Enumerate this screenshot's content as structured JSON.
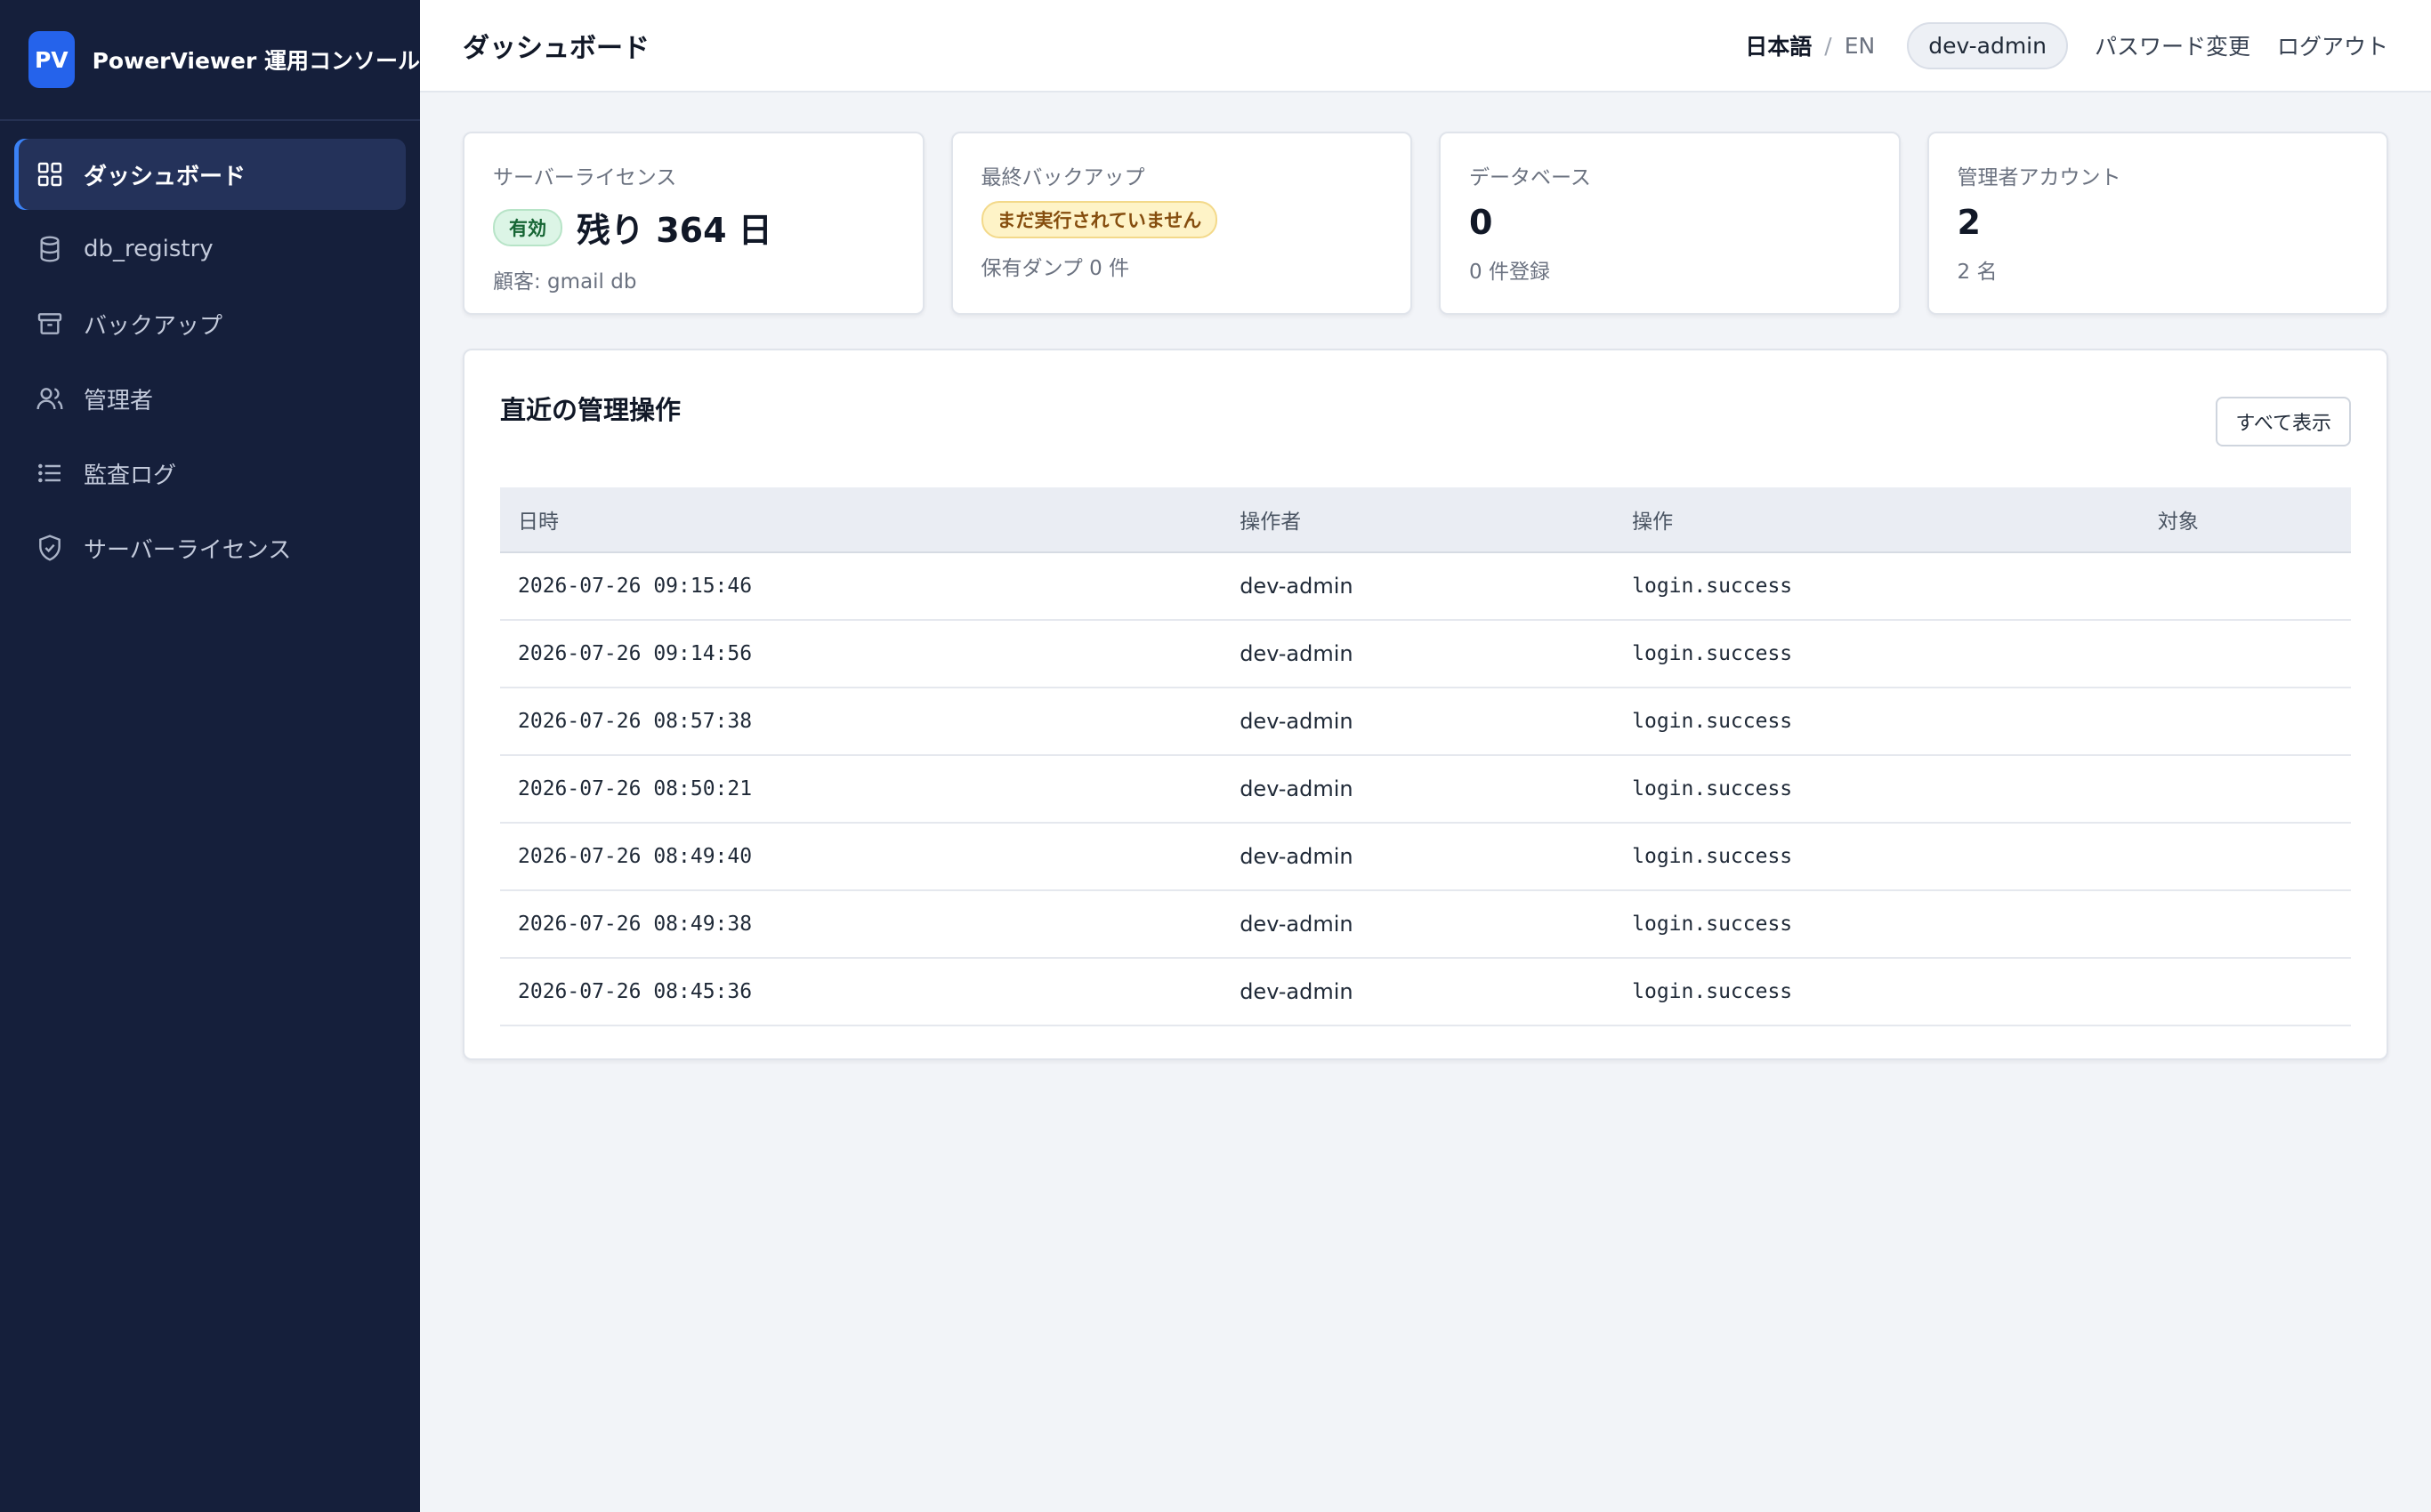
{
  "app": {
    "logo_text": "PV",
    "name": "PowerViewer 運用コンソール"
  },
  "sidebar": {
    "items": [
      {
        "label": "ダッシュボード",
        "icon": "grid-icon",
        "active": true
      },
      {
        "label": "db_registry",
        "icon": "database-icon"
      },
      {
        "label": "バックアップ",
        "icon": "archive-icon"
      },
      {
        "label": "管理者",
        "icon": "users-icon"
      },
      {
        "label": "監査ログ",
        "icon": "list-icon"
      },
      {
        "label": "サーバーライセンス",
        "icon": "shield-check-icon"
      }
    ]
  },
  "header": {
    "title": "ダッシュボード",
    "lang_ja": "日本語",
    "lang_sep": "/",
    "lang_en": "EN",
    "user": "dev-admin",
    "change_password": "パスワード変更",
    "logout": "ログアウト"
  },
  "cards": {
    "license": {
      "label": "サーバーライセンス",
      "badge": "有効",
      "value": "残り 364 日",
      "sub": "顧客: gmail db"
    },
    "backup": {
      "label": "最終バックアップ",
      "badge": "まだ実行されていません",
      "sub": "保有ダンプ 0 件"
    },
    "database": {
      "label": "データベース",
      "value": "0",
      "sub": "0 件登録"
    },
    "admins": {
      "label": "管理者アカウント",
      "value": "2",
      "sub": "2 名"
    }
  },
  "recent": {
    "title": "直近の管理操作",
    "show_all": "すべて表示",
    "columns": [
      "日時",
      "操作者",
      "操作",
      "対象"
    ],
    "rows": [
      {
        "time": "2026-07-26 09:15:46",
        "actor": "dev-admin",
        "action": "login.success",
        "target": ""
      },
      {
        "time": "2026-07-26 09:14:56",
        "actor": "dev-admin",
        "action": "login.success",
        "target": ""
      },
      {
        "time": "2026-07-26 08:57:38",
        "actor": "dev-admin",
        "action": "login.success",
        "target": ""
      },
      {
        "time": "2026-07-26 08:50:21",
        "actor": "dev-admin",
        "action": "login.success",
        "target": ""
      },
      {
        "time": "2026-07-26 08:49:40",
        "actor": "dev-admin",
        "action": "login.success",
        "target": ""
      },
      {
        "time": "2026-07-26 08:49:38",
        "actor": "dev-admin",
        "action": "login.success",
        "target": ""
      },
      {
        "time": "2026-07-26 08:45:36",
        "actor": "dev-admin",
        "action": "login.success",
        "target": ""
      }
    ]
  },
  "colors": {
    "sidebar_bg": "#151f3b",
    "accent": "#2563eb",
    "success": "#166534",
    "warning": "#854d0e"
  }
}
